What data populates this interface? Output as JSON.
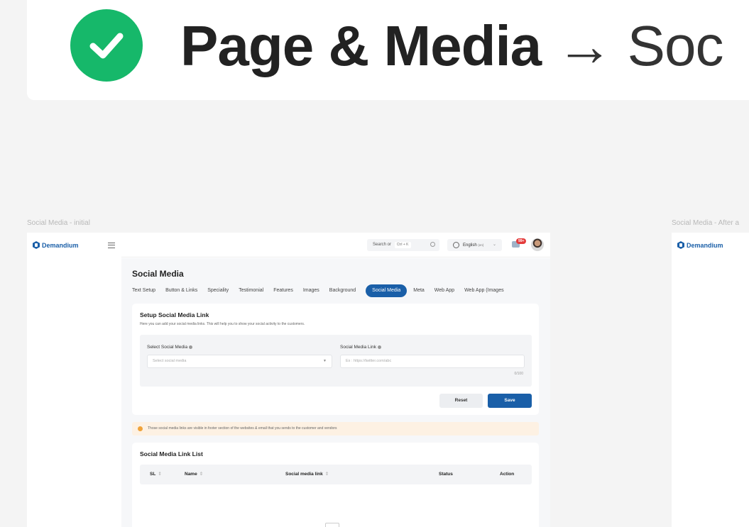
{
  "hero": {
    "title_bold": "Page & Media",
    "arrow": "→",
    "title_light": "Soc"
  },
  "frames": {
    "initial_label": "Social Media - initial",
    "after_label": "Social Media - After a"
  },
  "app": {
    "brand": "Demandium",
    "search_text": "Search or",
    "search_shortcut": "Ctrl + K",
    "language": "English",
    "language_code": "(en)",
    "notification_count": "99+"
  },
  "page": {
    "title": "Social Media",
    "tabs": [
      {
        "label": "Text Setup"
      },
      {
        "label": "Button & Links"
      },
      {
        "label": "Speciality"
      },
      {
        "label": "Testimonial"
      },
      {
        "label": "Features"
      },
      {
        "label": "Images"
      },
      {
        "label": "Background"
      },
      {
        "label": "Social Media"
      },
      {
        "label": "Meta"
      },
      {
        "label": "Web App"
      },
      {
        "label": "Web App (Images"
      }
    ],
    "active_tab": "Social Media"
  },
  "setup": {
    "heading": "Setup Social Media Link",
    "subheading": "Here you can add your social media links. This will help you to show your social activity to the customers.",
    "select_label": "Select Social Media",
    "select_placeholder": "Select social media",
    "link_label": "Social Media Link",
    "link_placeholder": "Ex : https://twitter.com/abc",
    "counter": "0/100",
    "reset_label": "Reset",
    "save_label": "Save"
  },
  "notice": {
    "text": "Those social media links are visible in footer section of the websites & email that you sends to the customer and vendors"
  },
  "list": {
    "heading": "Social Media Link List",
    "columns": [
      "SL",
      "Name",
      "Social media link",
      "Status",
      "Action"
    ]
  },
  "colors": {
    "primary": "#1a5fa8",
    "success": "#16b86a",
    "notice_bg": "#fdf1e3",
    "warning": "#f0a33a"
  },
  "icons": [
    "check-circle-icon",
    "logo-icon",
    "menu-icon",
    "search-icon",
    "globe-icon",
    "chevron-down-icon",
    "message-icon",
    "avatar",
    "info-icon",
    "sort-icon",
    "empty-state-icon"
  ]
}
